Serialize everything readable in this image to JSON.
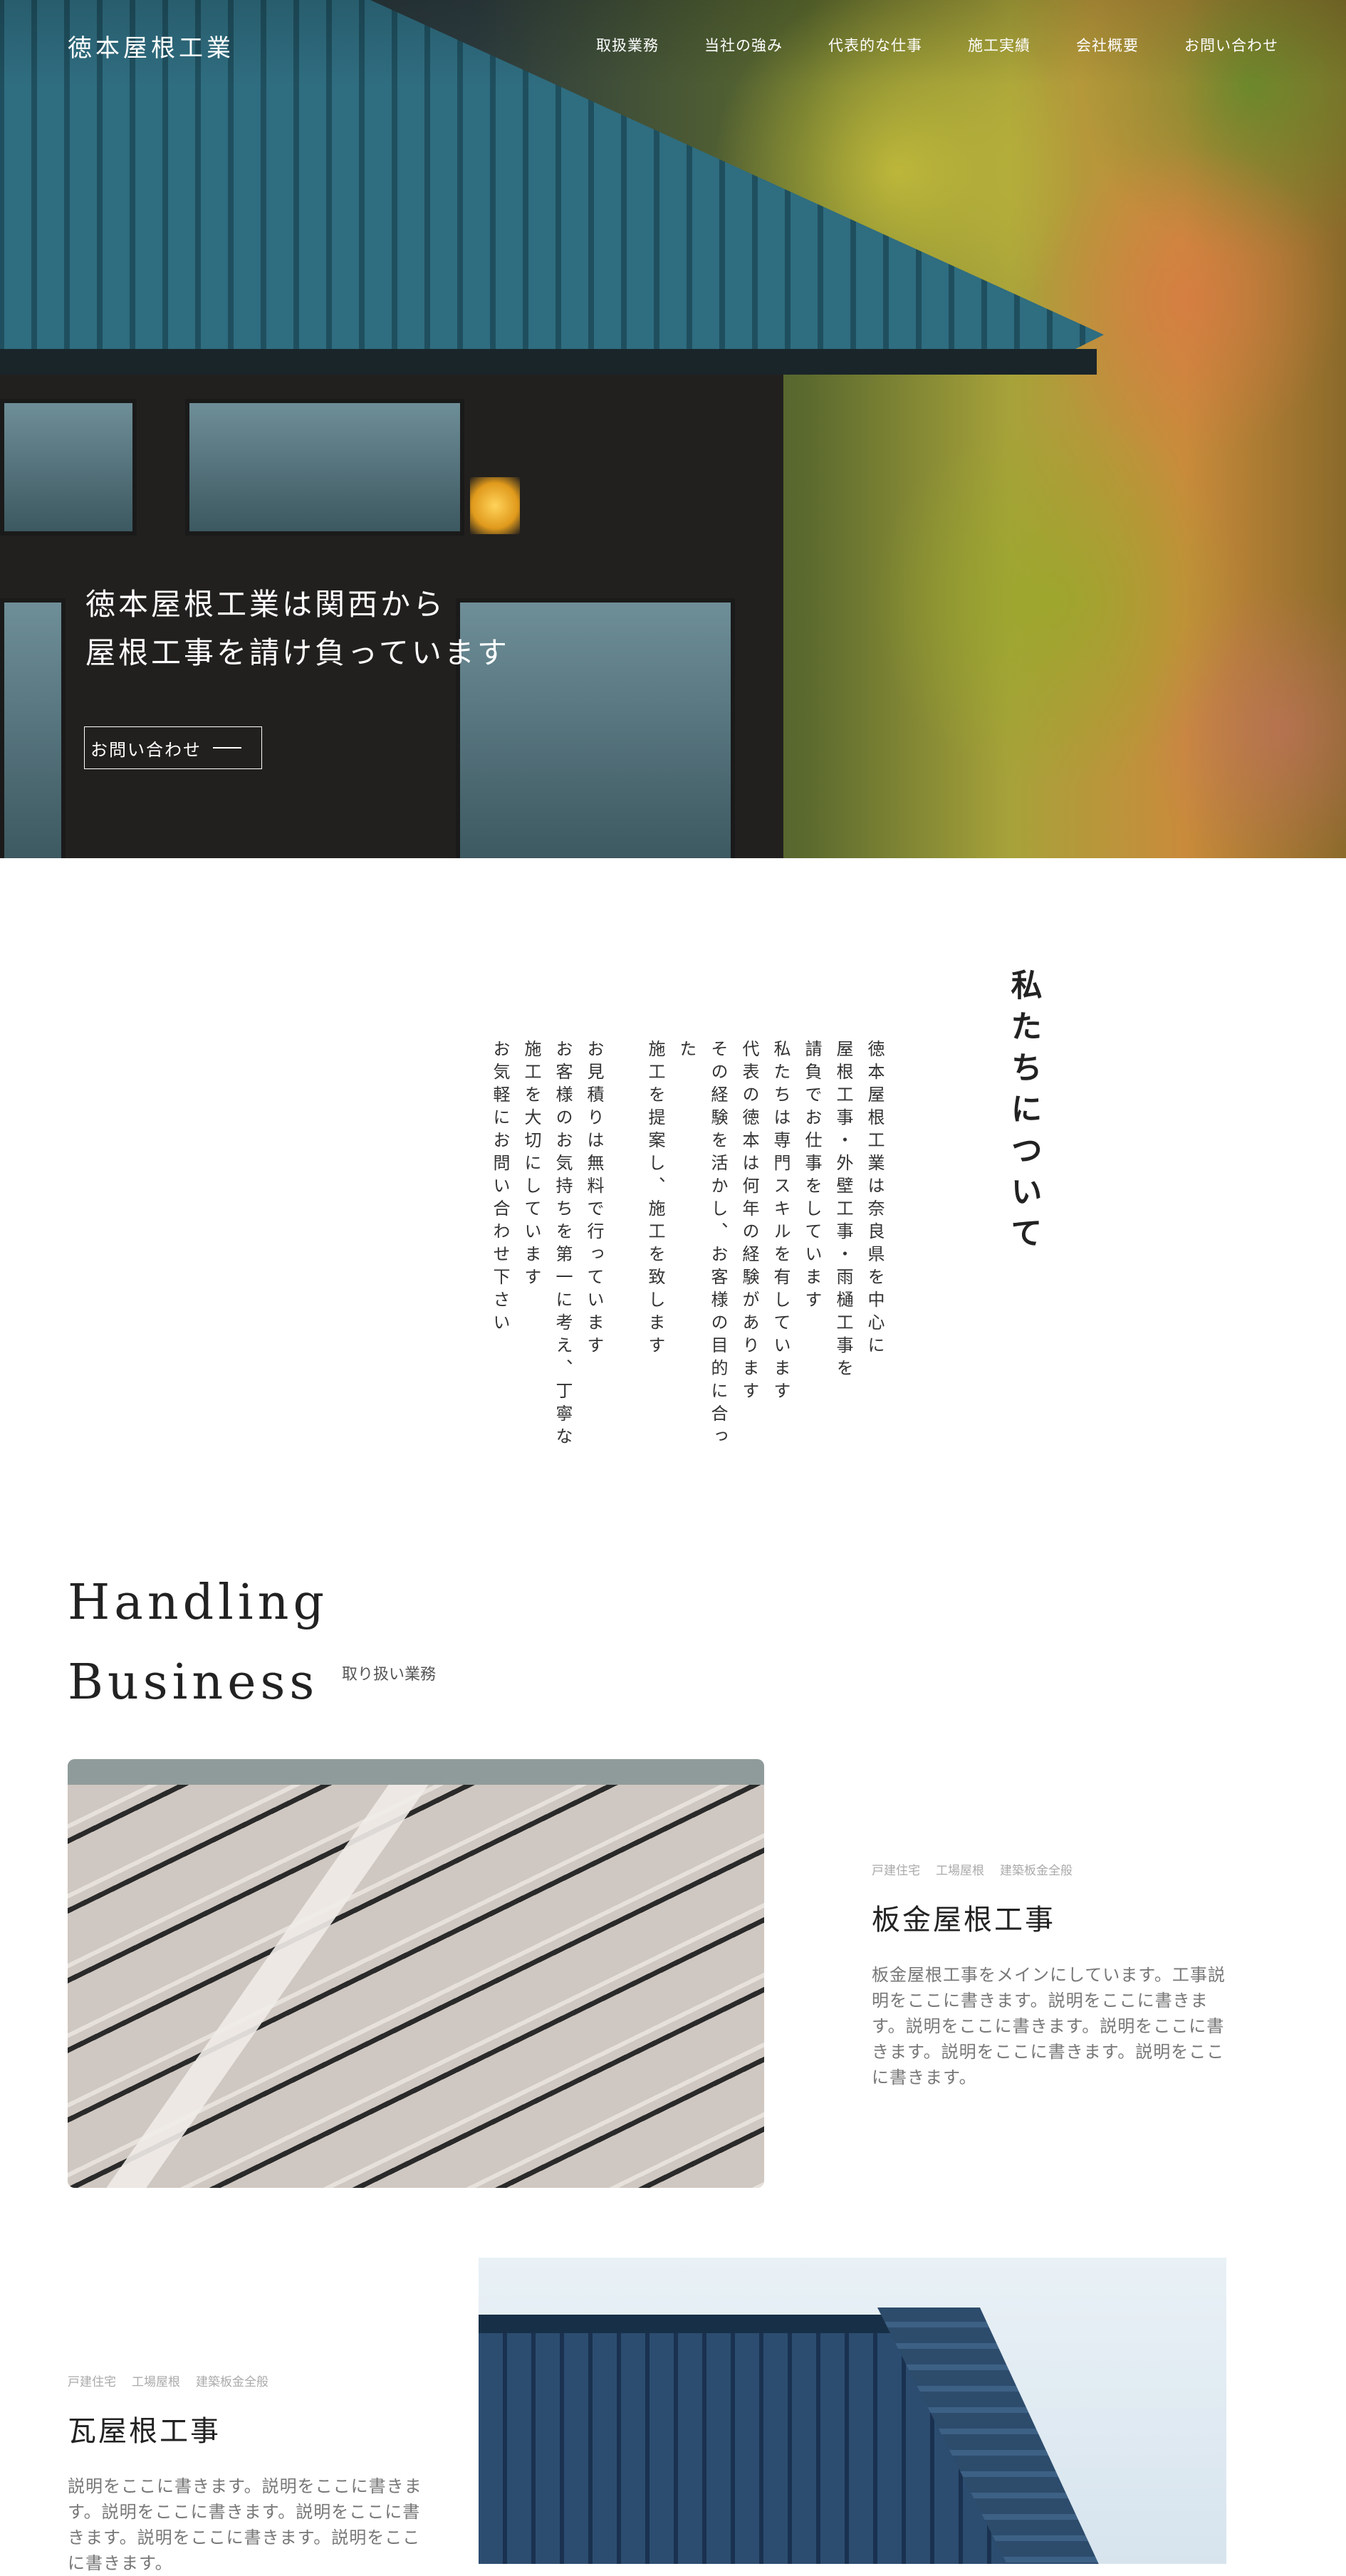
{
  "header": {
    "logo": "徳本屋根工業",
    "menu": [
      "取扱業務",
      "当社の強み",
      "代表的な仕事",
      "施工実績",
      "会社概要",
      "お問い合わせ"
    ]
  },
  "hero": {
    "line1": "徳本屋根工業は関西から",
    "line2": "屋根工事を請け負っています",
    "button_label": "お問い合わせ"
  },
  "about": {
    "title": "私たちについて",
    "paragraphs": [
      [
        "徳本屋根工業は奈良県を中心に",
        "屋根工事・外壁工事・雨樋工事を",
        "請負でお仕事をしています"
      ],
      [
        "私たちは専門スキルを有しています",
        "代表の徳本は何年の経験があります",
        "その経験を活かし、お客様の目的に合った",
        "施工を提案し、施工を致します"
      ],
      [
        "お見積りは無料で行っています",
        "お客様のお気持ちを第一に考え、丁寧な",
        "施工を大切にしています",
        "お気軽にお問い合わせ下さい"
      ]
    ]
  },
  "business": {
    "title_line1": "Handling",
    "title_line2": "Business",
    "subtitle": "取り扱い業務",
    "items": [
      {
        "tags": [
          "戸建住宅",
          "工場屋根",
          "建築板金全般"
        ],
        "title": "板金屋根工事",
        "desc": "板金屋根工事をメインにしています。工事説明をここに書きます。説明をここに書きます。説明をここに書きます。説明をここに書きます。説明をここに書きます。説明をここに書きます。"
      },
      {
        "tags": [
          "戸建住宅",
          "工場屋根",
          "建築板金全般"
        ],
        "title": "瓦屋根工事",
        "desc": "説明をここに書きます。説明をここに書きます。説明をここに書きます。説明をここに書きます。説明をここに書きます。説明をここに書きます。"
      }
    ]
  }
}
